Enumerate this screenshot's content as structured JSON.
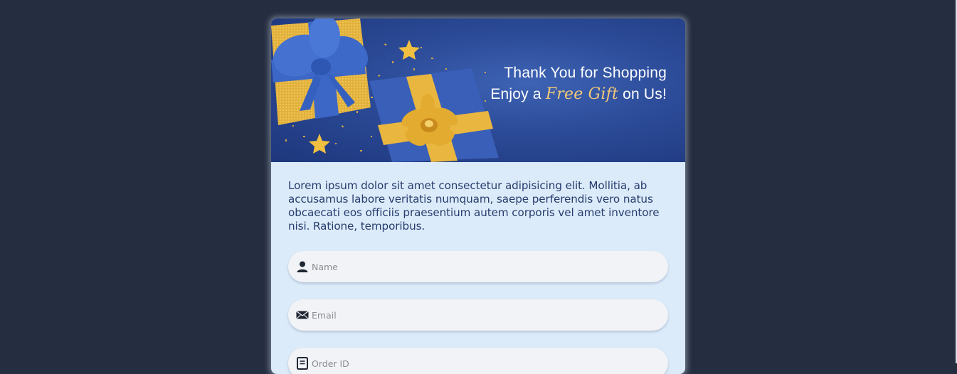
{
  "banner": {
    "line1": "Thank You for Shopping",
    "line2_pre": "Enjoy a",
    "line2_script": "Free Gift",
    "line2_post": "on Us!",
    "colors": {
      "background": "#2b4a97",
      "gold": "#e8b53a",
      "blue_box": "#3a5fb8"
    }
  },
  "intro": {
    "text": "Lorem ipsum dolor sit amet consectetur adipisicing elit. Mollitia, ab accusamus labore veritatis numquam, saepe perferendis vero natus obcaecati eos officiis praesentium autem corporis vel amet inventore nisi. Ratione, temporibus."
  },
  "form": {
    "fields": [
      {
        "icon": "user-icon",
        "placeholder": "Name",
        "value": ""
      },
      {
        "icon": "envelope-icon",
        "placeholder": "Email",
        "value": ""
      },
      {
        "icon": "receipt-icon",
        "placeholder": "Order ID",
        "value": ""
      }
    ]
  },
  "colors": {
    "page_background": "#252e40",
    "card_background": "#dcebf9",
    "text": "#263c6e",
    "input_background": "#f1f3f6"
  }
}
